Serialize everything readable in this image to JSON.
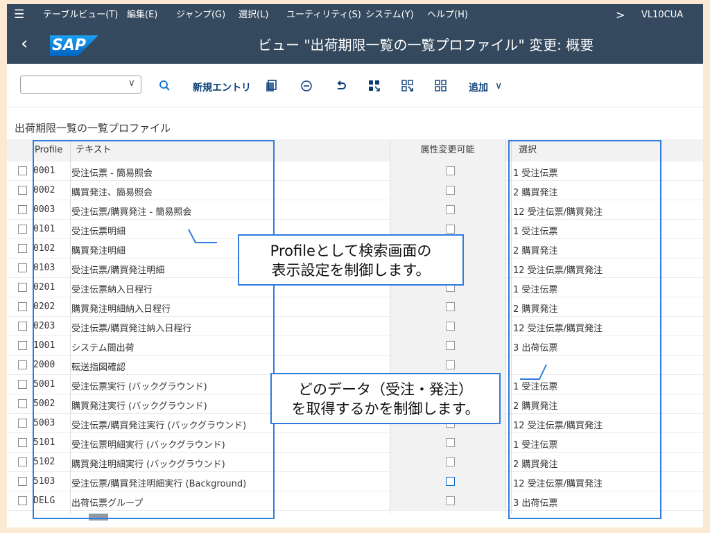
{
  "menu": {
    "items": [
      "テーブルビュー(T)",
      "編集(E)",
      "ジャンプ(G)",
      "選択(L)",
      "ユーティリティ(S)",
      "システム(Y)",
      "ヘルプ(H)"
    ],
    "tcode": "VL10CUA"
  },
  "titlebar": {
    "logo": "SAP",
    "title": "ビュー \"出荷期限一覧の一覧プロファイル\" 変更: 概要"
  },
  "toolbar": {
    "new_entry": "新規エントリ",
    "add": "追加"
  },
  "section_title": "出荷期限一覧の一覧プロファイル",
  "table": {
    "headers": {
      "profile": "Profile",
      "text": "テキスト",
      "attr": "属性変更可能",
      "selection": "選択"
    },
    "rows": [
      {
        "profile": "0001",
        "text": "受注伝票 - 簡易照会",
        "selection": "1 受注伝票"
      },
      {
        "profile": "0002",
        "text": "購買発注、簡易照会",
        "selection": "2 購買発注"
      },
      {
        "profile": "0003",
        "text": "受注伝票/購買発注 - 簡易照会",
        "selection": "12 受注伝票/購買発注"
      },
      {
        "profile": "0101",
        "text": "受注伝票明細",
        "selection": "1 受注伝票"
      },
      {
        "profile": "0102",
        "text": "購買発注明細",
        "selection": "2 購買発注"
      },
      {
        "profile": "0103",
        "text": "受注伝票/購買発注明細",
        "selection": "12 受注伝票/購買発注"
      },
      {
        "profile": "0201",
        "text": "受注伝票納入日程行",
        "selection": "1 受注伝票"
      },
      {
        "profile": "0202",
        "text": "購買発注明細納入日程行",
        "selection": "2 購買発注"
      },
      {
        "profile": "0203",
        "text": "受注伝票/購買発注納入日程行",
        "selection": "12 受注伝票/購買発注"
      },
      {
        "profile": "1001",
        "text": "システム間出荷",
        "selection": "3 出荷伝票"
      },
      {
        "profile": "2000",
        "text": "転送指図確認",
        "selection": ""
      },
      {
        "profile": "5001",
        "text": "受注伝票実行 (バックグラウンド)",
        "selection": "1 受注伝票"
      },
      {
        "profile": "5002",
        "text": "購買発注実行 (バックグラウンド)",
        "selection": "2 購買発注"
      },
      {
        "profile": "5003",
        "text": "受注伝票/購買発注実行 (バックグラウンド)",
        "selection": "12 受注伝票/購買発注"
      },
      {
        "profile": "5101",
        "text": "受注伝票明細実行 (バックグラウンド)",
        "selection": "1 受注伝票"
      },
      {
        "profile": "5102",
        "text": "購買発注明細実行 (バックグラウンド)",
        "selection": "2 購買発注"
      },
      {
        "profile": "5103",
        "text": "受注伝票/購買発注明細実行 (Background)",
        "selection": "12 受注伝票/購買発注"
      },
      {
        "profile": "DELG",
        "text": "出荷伝票グループ",
        "selection": "3 出荷伝票"
      }
    ]
  },
  "annotations": {
    "callout1": [
      "Profileとして検索画面の",
      "表示設定を制御します。"
    ],
    "callout2": [
      "どのデータ（受注・発注）",
      "を取得するかを制御します。"
    ]
  },
  "colors": {
    "shell": "#354a5f",
    "accent": "#0a6ed1",
    "annotation": "#2f7be0",
    "frame": "#fbe9d2"
  }
}
